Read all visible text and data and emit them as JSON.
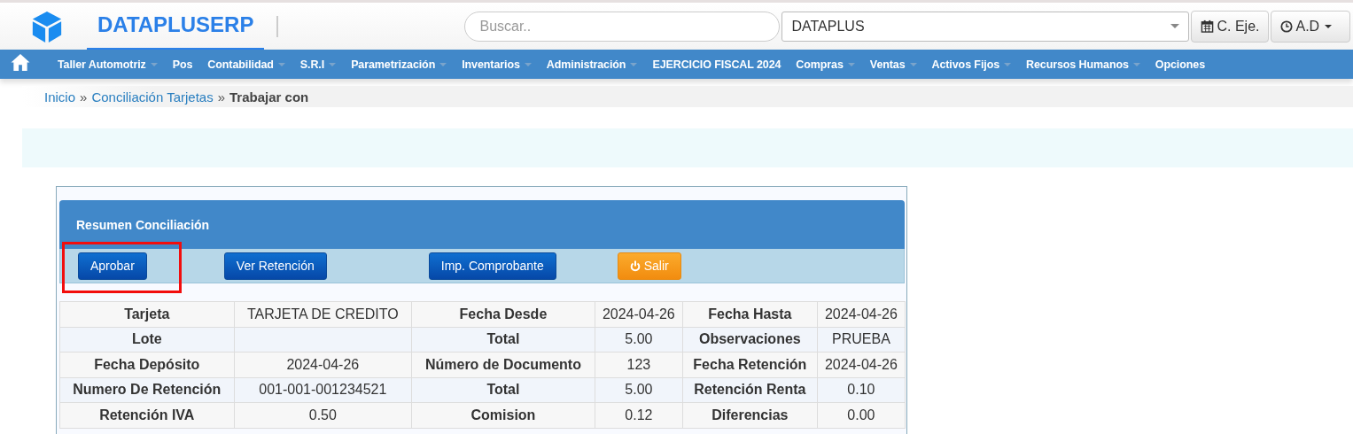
{
  "brand": {
    "name": "DATAPLUSERP"
  },
  "search": {
    "placeholder": "Buscar.."
  },
  "company_select": {
    "value": "DATAPLUS"
  },
  "header_buttons": [
    {
      "label": "C. Eje.",
      "kind": "calendar"
    },
    {
      "label": "A.D",
      "kind": "clock"
    }
  ],
  "nav": [
    {
      "label": "Taller Automotriz",
      "has_menu": true
    },
    {
      "label": "Pos",
      "has_menu": false
    },
    {
      "label": "Contabilidad",
      "has_menu": true
    },
    {
      "label": "S.R.I",
      "has_menu": true
    },
    {
      "label": "Parametrización",
      "has_menu": true
    },
    {
      "label": "Inventarios",
      "has_menu": true
    },
    {
      "label": "Administración",
      "has_menu": true
    },
    {
      "label": "EJERCICIO FISCAL 2024",
      "has_menu": false
    },
    {
      "label": "Compras",
      "has_menu": true
    },
    {
      "label": "Ventas",
      "has_menu": true
    },
    {
      "label": "Activos Fijos",
      "has_menu": true
    },
    {
      "label": "Recursos Humanos",
      "has_menu": true
    },
    {
      "label": "Opciones",
      "has_menu": false
    }
  ],
  "breadcrumb": [
    {
      "label": "Inicio",
      "kind": "link"
    },
    {
      "separator": "»",
      "label": "Conciliación Tarjetas",
      "kind": "link"
    },
    {
      "separator": "»",
      "label": "Trabajar con",
      "kind": "current"
    }
  ],
  "panel": {
    "title": "Resumen Conciliación",
    "buttons": [
      {
        "label": "Aprobar",
        "kind": "primary",
        "highlighted": true
      },
      {
        "label": "Ver Retención",
        "kind": "primary",
        "highlighted": false
      },
      {
        "label": "Imp. Comprobante",
        "kind": "primary",
        "highlighted": false
      },
      {
        "label": "Salir",
        "kind": "warning",
        "highlighted": false
      }
    ],
    "rows": [
      [
        {
          "label": "Tarjeta",
          "value": "TARJETA DE CREDITO"
        },
        {
          "label": "Fecha Desde",
          "value": "2024-04-26"
        },
        {
          "label": "Fecha Hasta",
          "value": "2024-04-26"
        }
      ],
      [
        {
          "label": "Lote"
        },
        {
          "label": "Total",
          "value": "5.00"
        },
        {
          "label": "Observaciones",
          "value": "PRUEBA"
        }
      ],
      [
        {
          "label": "Fecha Depósito",
          "value": "2024-04-26"
        },
        {
          "label": "Número de Documento",
          "value": "123"
        },
        {
          "label": "Fecha Retención",
          "value": "2024-04-26"
        }
      ],
      [
        {
          "label": "Numero De Retención",
          "value": "001-001-001234521"
        },
        {
          "label": "Total",
          "value": "5.00"
        },
        {
          "label": "Retención Renta",
          "value": "0.10"
        }
      ],
      [
        {
          "label": "Retención IVA",
          "value": "0.50"
        },
        {
          "label": "Comision",
          "value": "0.12"
        },
        {
          "label": "Diferencias",
          "value": "0.00"
        }
      ]
    ]
  }
}
